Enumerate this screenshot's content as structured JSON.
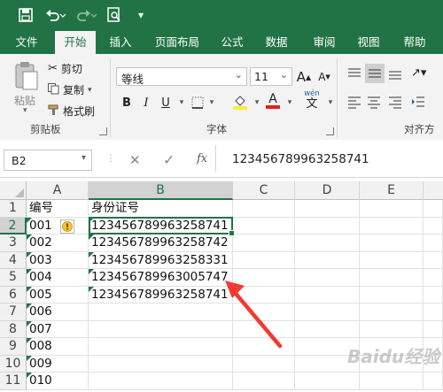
{
  "qat": {
    "save_icon": "save-icon",
    "undo_icon": "undo-icon",
    "redo_icon": "redo-icon",
    "preview_icon": "print-preview-icon",
    "customize_icon": "customize-qat-icon"
  },
  "tabs": [
    "文件",
    "开始",
    "插入",
    "页面布局",
    "公式",
    "数据",
    "审阅",
    "视图",
    "帮助"
  ],
  "active_tab": "开始",
  "ribbon": {
    "paste_label": "粘贴",
    "cut_label": "剪切",
    "copy_label": "复制",
    "format_painter_label": "格式刷",
    "clipboard_group": "剪贴板",
    "font_name": "等线",
    "font_size": "11",
    "grow_font": "A",
    "shrink_font": "A",
    "bold": "B",
    "italic": "I",
    "underline": "U",
    "font_color_letter": "A",
    "phonetic": "wén",
    "phonetic_char": "文",
    "font_group": "字体",
    "align_group": "对齐方",
    "colors": {
      "fill": "#ffeb3b",
      "font": "#e02020",
      "accent": "#217346"
    }
  },
  "formula_bar": {
    "name_box": "B2",
    "fx": "fx",
    "value": "123456789963258741"
  },
  "grid": {
    "columns": [
      "A",
      "B",
      "C",
      "D",
      "E"
    ],
    "rows": [
      "1",
      "2",
      "3",
      "4",
      "5",
      "6",
      "7",
      "8",
      "9",
      "10",
      "11"
    ],
    "col_a": [
      "编号",
      "001",
      "002",
      "003",
      "004",
      "005",
      "006",
      "007",
      "008",
      "009",
      "010",
      ""
    ],
    "col_b": [
      "身份证号",
      "123456789963258741",
      "123456789963258742",
      "123456789963258331",
      "123456789963005747",
      "123456789963258741"
    ],
    "warning_icon": "warning-icon",
    "arrow_color": "#f23b2f"
  },
  "watermark": "Baidu经验"
}
